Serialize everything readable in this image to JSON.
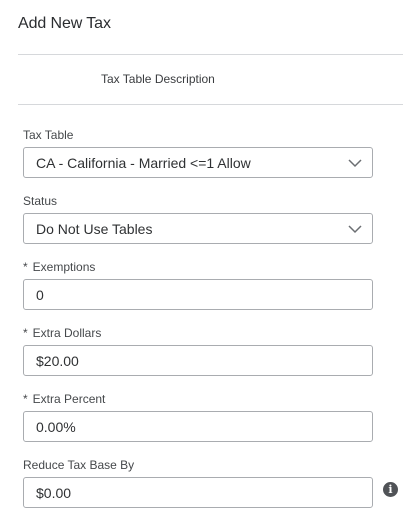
{
  "header": {
    "title": "Add New Tax"
  },
  "tabs": {
    "description_label": "Tax Table Description"
  },
  "form": {
    "tax_table": {
      "label": "Tax Table",
      "value": "CA - California - Married <=1 Allow"
    },
    "status": {
      "label": "Status",
      "value": "Do Not Use Tables"
    },
    "exemptions": {
      "required": "*",
      "label": "Exemptions",
      "value": "0"
    },
    "extra_dollars": {
      "required": "*",
      "label": "Extra Dollars",
      "value": "$20.00"
    },
    "extra_percent": {
      "required": "*",
      "label": "Extra Percent",
      "value": "0.00%"
    },
    "reduce_tax_base": {
      "label": "Reduce Tax Base By",
      "value": "$0.00"
    }
  },
  "icons": {
    "dropdown": "chevron-down-icon",
    "info": "info-icon",
    "info_glyph": "i"
  },
  "colors": {
    "border": "#a9acb0",
    "divider": "#d6d8db",
    "info_icon": "#505357"
  }
}
